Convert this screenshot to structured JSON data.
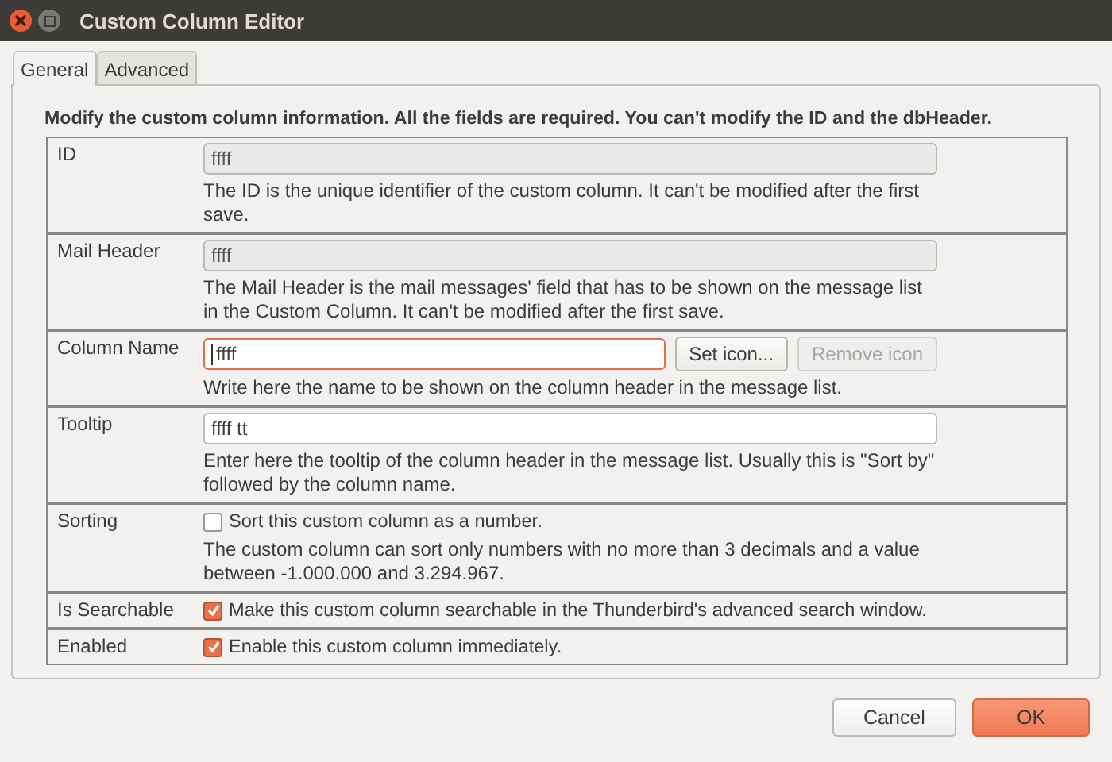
{
  "window": {
    "title": "Custom Column Editor"
  },
  "tabs": [
    {
      "label": "General",
      "selected": true
    },
    {
      "label": "Advanced",
      "selected": false
    }
  ],
  "heading": "Modify the custom column information. All the fields are required. You can't modify the ID and the dbHeader.",
  "rows": [
    {
      "label": "ID",
      "kind": "field",
      "value": "ffff",
      "disabled": true,
      "focused": false,
      "description": "The ID is the unique identifier of the custom column. It can't be modified after the first save."
    },
    {
      "label": "Mail Header",
      "kind": "field",
      "value": "ffff",
      "disabled": true,
      "focused": false,
      "description": "The Mail Header is the mail messages' field that has to be shown on the message list in the Custom Column. It can't be modified after the first save."
    },
    {
      "label": "Column Name",
      "kind": "field",
      "value": "ffff",
      "disabled": false,
      "focused": true,
      "buttons": [
        {
          "label": "Set icon...",
          "disabled": false
        },
        {
          "label": "Remove icon",
          "disabled": true
        }
      ],
      "description": "Write here the name to be shown on the column header in the message list."
    },
    {
      "label": "Tooltip",
      "kind": "field",
      "value": "ffff tt",
      "disabled": false,
      "focused": false,
      "description": "Enter here the tooltip of the column header in the message list. Usually this is \"Sort by\" followed by the column name."
    },
    {
      "label": "Sorting",
      "kind": "checkbox",
      "option": "Sort this custom column as a number.",
      "checked": false,
      "description": "The custom column can sort only numbers with no more than 3 decimals and a value between -1.000.000 and 3.294.967."
    },
    {
      "label": "Is Searchable",
      "kind": "checkbox",
      "option": "Make this custom column searchable in the Thunderbird's advanced search window.",
      "checked": true
    },
    {
      "label": "Enabled",
      "kind": "checkbox",
      "option": "Enable this custom column immediately.",
      "checked": true
    }
  ],
  "buttons": [
    {
      "label": "Cancel",
      "kind": "secondary"
    },
    {
      "label": "OK",
      "kind": "primary"
    }
  ]
}
